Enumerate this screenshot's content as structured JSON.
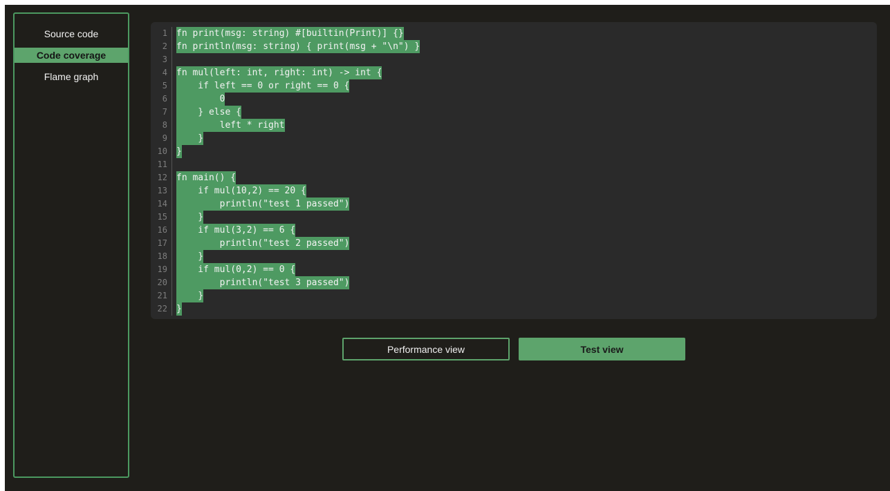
{
  "sidebar": {
    "items": [
      {
        "label": "Source code",
        "active": false
      },
      {
        "label": "Code coverage",
        "active": true
      },
      {
        "label": "Flame graph",
        "active": false
      }
    ]
  },
  "code": {
    "lines": [
      {
        "n": "1",
        "indent": "",
        "text": "fn print(msg: string) #[builtin(Print)] {}"
      },
      {
        "n": "2",
        "indent": "",
        "text": "fn println(msg: string) { print(msg + \"\\n\") }"
      },
      {
        "n": "3",
        "indent": "",
        "text": ""
      },
      {
        "n": "4",
        "indent": "",
        "text": "fn mul(left: int, right: int) -> int {"
      },
      {
        "n": "5",
        "indent": "    ",
        "text": "if left == 0 or right == 0 {"
      },
      {
        "n": "6",
        "indent": "        ",
        "text": "0"
      },
      {
        "n": "7",
        "indent": "    ",
        "text": "} else {"
      },
      {
        "n": "8",
        "indent": "        ",
        "text": "left * right"
      },
      {
        "n": "9",
        "indent": "    ",
        "text": "}"
      },
      {
        "n": "10",
        "indent": "",
        "text": "}"
      },
      {
        "n": "11",
        "indent": "",
        "text": ""
      },
      {
        "n": "12",
        "indent": "",
        "text": "fn main() {"
      },
      {
        "n": "13",
        "indent": "    ",
        "text": "if mul(10,2) == 20 {"
      },
      {
        "n": "14",
        "indent": "        ",
        "text": "println(\"test 1 passed\")"
      },
      {
        "n": "15",
        "indent": "    ",
        "text": "}"
      },
      {
        "n": "16",
        "indent": "    ",
        "text": "if mul(3,2) == 6 {"
      },
      {
        "n": "17",
        "indent": "        ",
        "text": "println(\"test 2 passed\")"
      },
      {
        "n": "18",
        "indent": "    ",
        "text": "}"
      },
      {
        "n": "19",
        "indent": "    ",
        "text": "if mul(0,2) == 0 {"
      },
      {
        "n": "20",
        "indent": "        ",
        "text": "println(\"test 3 passed\")"
      },
      {
        "n": "21",
        "indent": "    ",
        "text": "}"
      },
      {
        "n": "22",
        "indent": "",
        "text": "}"
      }
    ]
  },
  "buttons": {
    "performance_view": "Performance view",
    "test_view": "Test view"
  },
  "colors": {
    "accent": "#5da46c",
    "coverage_highlight": "#4e9a62",
    "background": "#1f1e1a",
    "code_panel": "#2a2a2a"
  }
}
